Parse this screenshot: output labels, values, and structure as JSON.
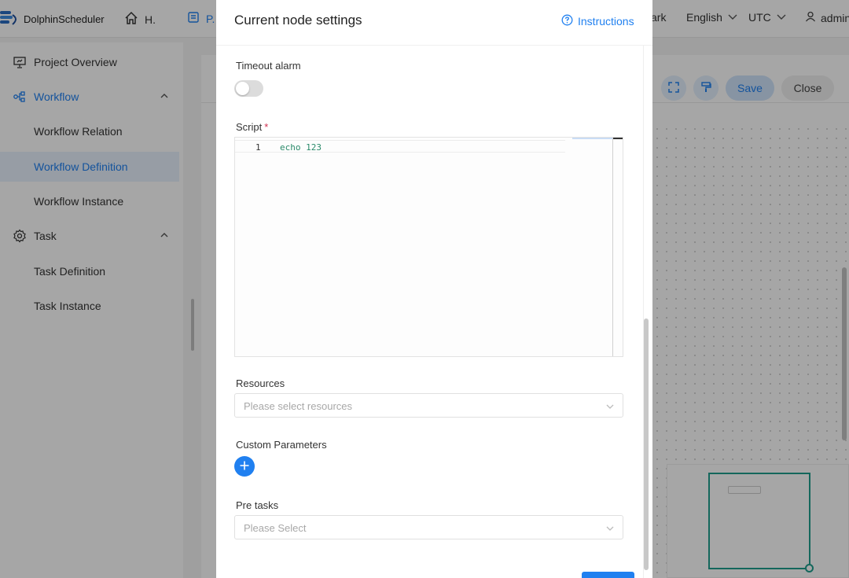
{
  "app": {
    "name": "DolphinScheduler",
    "nav_home": "H.",
    "nav_project": "P.",
    "nav_dark": "ark",
    "language": "English",
    "timezone": "UTC",
    "user": "admin"
  },
  "sidebar": {
    "items": [
      {
        "label": "Project Overview",
        "icon": "presentation-icon"
      },
      {
        "label": "Workflow",
        "icon": "workflow-icon"
      },
      {
        "label": "Workflow Relation"
      },
      {
        "label": "Workflow Definition"
      },
      {
        "label": "Workflow Instance"
      },
      {
        "label": "Task",
        "icon": "gear-icon"
      },
      {
        "label": "Task Definition"
      },
      {
        "label": "Task Instance"
      }
    ]
  },
  "toolbar": {
    "save_label": "Save",
    "close_label": "Close"
  },
  "drawer": {
    "title": "Current node settings",
    "instructions_label": "Instructions",
    "timeout_alarm_label": "Timeout alarm",
    "timeout_alarm_enabled": false,
    "script_label": "Script",
    "script_required": "*",
    "script_lines": [
      {
        "no": "1",
        "code": "echo 123"
      }
    ],
    "resources_label": "Resources",
    "resources_placeholder": "Please select resources",
    "custom_params_label": "Custom Parameters",
    "pre_tasks_label": "Pre tasks",
    "pre_tasks_placeholder": "Please Select"
  },
  "colors": {
    "accent": "#2080f0",
    "minimap": "#1f9e8e",
    "required": "#d03050"
  }
}
